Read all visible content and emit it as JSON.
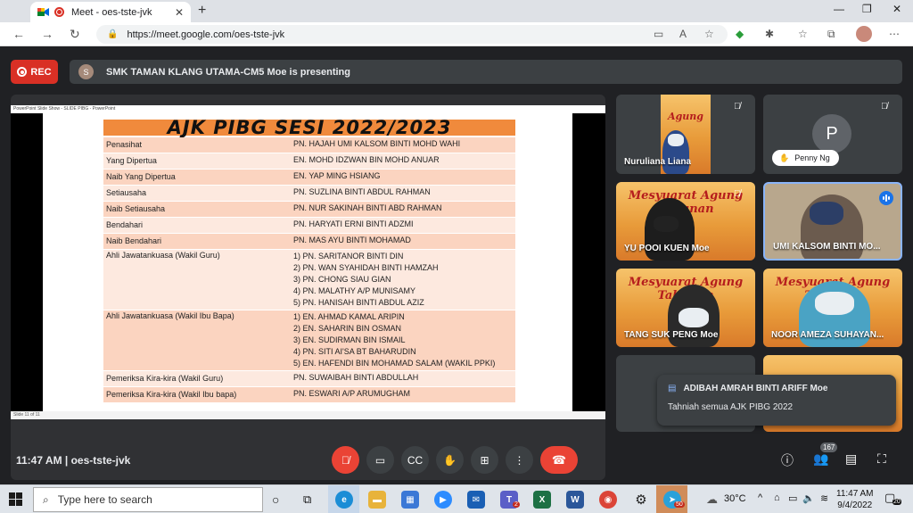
{
  "browser": {
    "tab_title": "Meet - oes-tste-jvk",
    "tab_close": "✕",
    "new_tab": "+",
    "url": "https://meet.google.com/oes-tste-jvk"
  },
  "meet": {
    "rec_label": "REC",
    "presenter_initial": "S",
    "presenting_text": "SMK TAMAN KLANG UTAMA-CM5 Moe is presenting",
    "slide": {
      "app_title": "PowerPoint Slide Show - SLIDE PIBG - PowerPoint",
      "status_text": "Slide 11 of 11",
      "heading": "AJK PIBG SESI 2022/2023",
      "rows": [
        {
          "role": "Penasihat",
          "names": [
            "PN. HAJAH UMI KALSOM BINTI MOHD WAHI"
          ]
        },
        {
          "role": "Yang Dipertua",
          "names": [
            "EN. MOHD IDZWAN BIN MOHD ANUAR"
          ]
        },
        {
          "role": "Naib Yang Dipertua",
          "names": [
            "EN. YAP MING HSIANG"
          ]
        },
        {
          "role": "Setiausaha",
          "names": [
            "PN. SUZLINA BINTI ABDUL RAHMAN"
          ]
        },
        {
          "role": "Naib Setiausaha",
          "names": [
            "PN. NUR SAKINAH BINTI ABD RAHMAN"
          ]
        },
        {
          "role": "Bendahari",
          "names": [
            "PN. HARYATI ERNI BINTI ADZMI"
          ]
        },
        {
          "role": "Naib Bendahari",
          "names": [
            "PN. MAS AYU BINTI MOHAMAD"
          ]
        },
        {
          "role": "Ahli Jawatankuasa (Wakil Guru)",
          "names": [
            "1) PN. SARITANOR BINTI DIN",
            "2) PN. WAN SYAHIDAH BINTI HAMZAH",
            "3) PN. CHONG SIAU GIAN",
            "4) PN. MALATHY A/P MUNISAMY",
            "5) PN. HANISAH BINTI ABDUL AZIZ"
          ]
        },
        {
          "role": "Ahli Jawatankuasa (Wakil Ibu Bapa)",
          "names": [
            "1) EN. AHMAD KAMAL ARIPIN",
            "2) EN. SAHARIN BIN OSMAN",
            "3) EN. SUDIRMAN BIN ISMAIL",
            "4) PN. SITI AI'SA BT BAHARUDIN",
            "5) EN. HAFENDI BIN MOHAMAD SALAM (WAKIL PPKI)"
          ]
        },
        {
          "role": "Pemeriksa Kira-kira (Wakil Guru)",
          "names": [
            "PN. SUWAIBAH BINTI ABDULLAH"
          ]
        },
        {
          "role": "Pemeriksa Kira-kira (Wakil Ibu bapa)",
          "names": [
            "PN. ESWARI A/P ARUMUGHAM"
          ]
        }
      ]
    },
    "tiles": {
      "t1_name": "Nuruliana Liana",
      "t1_banner": "Agung",
      "t2_initial": "P",
      "t2_name": "Penny Ng",
      "t3_name": "YU POOI KUEN Moe",
      "t3_banner": "Mesyuarat Agung Tahunan",
      "t4_name": "UMI KALSOM BINTI MO...",
      "t5_name": "TANG SUK PENG Moe",
      "t5_banner": "Mesyuarat Agung Tahunan",
      "t6_name": "NOOR AMEZA SUHAYAN...",
      "t6_banner": "Mesyuarat Agung Tahunan"
    },
    "chat": {
      "sender": "ADIBAH AMRAH BINTI ARIFF Moe",
      "message": "Tahniah semua AJK PIBG 2022"
    },
    "bottom": {
      "time_code": "11:47 AM  |  oes-tste-jvk",
      "participant_count": "167",
      "chat_badge": ""
    }
  },
  "taskbar": {
    "search_placeholder": "Type here to search",
    "weather": "30°C",
    "time": "11:47 AM",
    "date": "9/4/2022",
    "notif_count": "20",
    "teams_badge": "2",
    "telegram_badge": "50"
  },
  "colors": {
    "accent_red": "#ea4335",
    "slide_orange": "#f08a3c",
    "row_odd": "#fbd4c0",
    "row_even": "#fde9df"
  }
}
